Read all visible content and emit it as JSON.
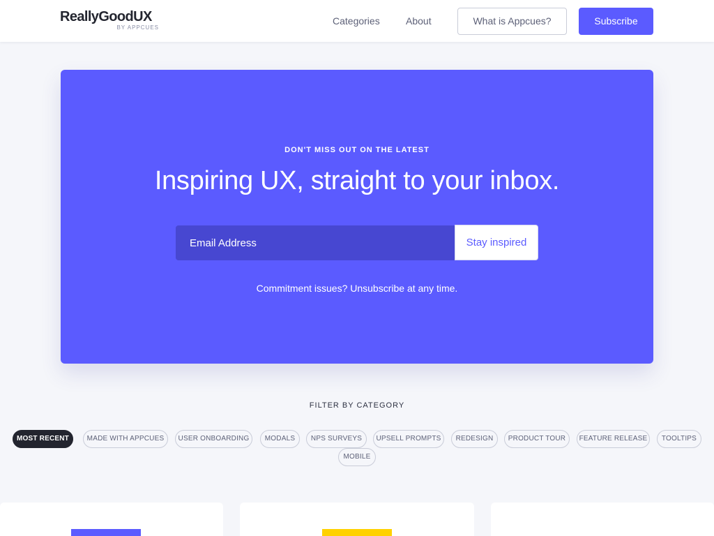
{
  "header": {
    "logo_main": "ReallyGoodUX",
    "logo_sub": "BY APPCUES",
    "nav": {
      "categories": "Categories",
      "about": "About",
      "what_is": "What is Appcues?",
      "subscribe": "Subscribe"
    }
  },
  "hero": {
    "eyebrow": "DON'T MISS OUT ON THE LATEST",
    "title": "Inspiring UX, straight to your inbox.",
    "email_placeholder": "Email Address",
    "cta": "Stay inspired",
    "note": "Commitment issues? Unsubscribe at any time."
  },
  "filter": {
    "title": "FILTER BY CATEGORY",
    "chips": [
      "MOST RECENT",
      "MADE WITH APPCUES",
      "USER ONBOARDING",
      "MODALS",
      "NPS SURVEYS",
      "UPSELL PROMPTS",
      "REDESIGN",
      "PRODUCT TOUR",
      "FEATURE RELEASE",
      "TOOLTIPS",
      "MOBILE"
    ],
    "active_chip": "MOST RECENT"
  },
  "colors": {
    "brand": "#5b5bff",
    "brand_dark": "#4747d1",
    "ink": "#23252f",
    "card_accent_1": "#5b5bff",
    "card_accent_2": "#ffd100"
  }
}
